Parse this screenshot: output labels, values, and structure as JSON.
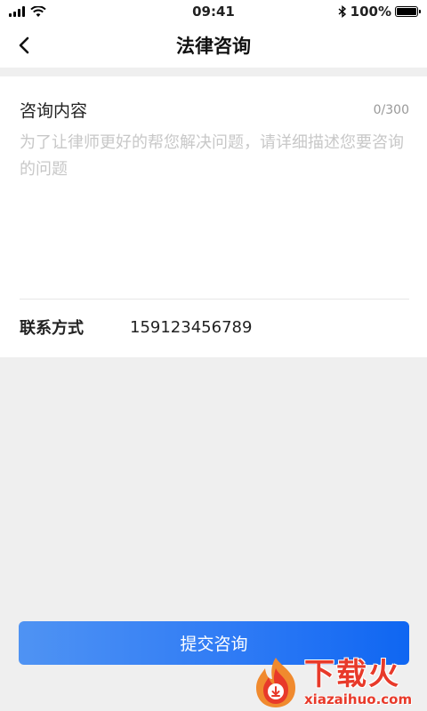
{
  "status_bar": {
    "time": "09:41",
    "battery": "100%",
    "battery_level": 1.0
  },
  "nav": {
    "title": "法律咨询",
    "back_icon": "chevron-left-icon"
  },
  "consult": {
    "label": "咨询内容",
    "char_count": "0/300",
    "placeholder": "为了让律师更好的帮您解决问题，请详细描述您要咨询的问题",
    "value": ""
  },
  "contact": {
    "label": "联系方式",
    "value": "15912345678​9"
  },
  "submit": {
    "label": "提交咨询"
  },
  "watermark": {
    "title": "下载火",
    "subtitle": "xiazaihuo.com"
  },
  "colors": {
    "accent": "#2f7bf5",
    "page_background": "#efefef",
    "watermark": "#e83a2a"
  }
}
